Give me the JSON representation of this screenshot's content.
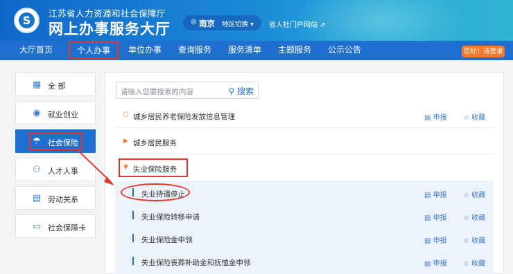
{
  "header": {
    "subtitle": "江苏省人力资源和社会保障厅",
    "title": "网上办事服务大厅",
    "city": "南京",
    "region_switch": "地区切换 ▾",
    "portal_link": "省人社门户网站 ⇗",
    "login": "您好！请登录"
  },
  "nav": {
    "items": [
      "大厅首页",
      "个人办事",
      "单位办事",
      "查询服务",
      "服务清单",
      "主题服务",
      "公示公告"
    ]
  },
  "sidebar": {
    "items": [
      {
        "label": "全 部",
        "icon": "grid-icon"
      },
      {
        "label": "就业创业",
        "icon": "briefcase-icon"
      },
      {
        "label": "社会保险",
        "icon": "umbrella-icon"
      },
      {
        "label": "人才人事",
        "icon": "people-icon"
      },
      {
        "label": "劳动关系",
        "icon": "document-icon"
      },
      {
        "label": "社会保障卡",
        "icon": "card-icon"
      }
    ],
    "active": "社会保险"
  },
  "search": {
    "placeholder": "请输入您要搜索的内容",
    "button": "搜索"
  },
  "services": [
    {
      "label": "城乡居民养老保险发放信息管理",
      "apply": "申报",
      "fav": "收藏"
    },
    {
      "label": "城乡居民服务"
    },
    {
      "label": "失业保险服务"
    }
  ],
  "subservices": [
    {
      "label": "失业待遇停止",
      "apply": "申报",
      "fav": "收藏"
    },
    {
      "label": "失业保险转移申请",
      "apply": "申报",
      "fav": "收藏"
    },
    {
      "label": "失业保险金申领",
      "apply": "申报",
      "fav": "收藏"
    },
    {
      "label": "失业保险丧葬补助金和抚恤金申领",
      "apply": "申报",
      "fav": "收藏"
    }
  ],
  "colors": {
    "brand": "#1e6fd0",
    "highlight": "#e4372b",
    "login": "#f37a2d",
    "bullet": "#f37a2d"
  }
}
